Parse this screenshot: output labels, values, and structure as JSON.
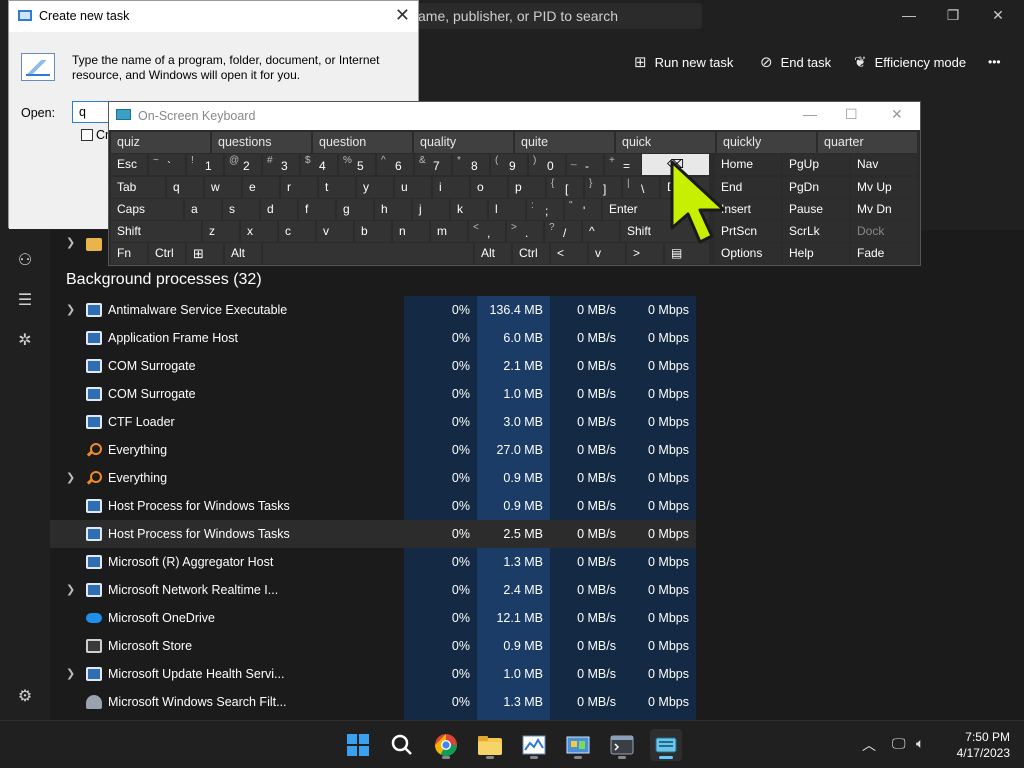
{
  "task_manager": {
    "search_placeholder": "ame, publisher, or PID to search",
    "window_controls": {
      "minimize": "—",
      "maximize": "❐",
      "close": "✕"
    },
    "toolbar": {
      "run_new_task": "Run new task",
      "end_task": "End task",
      "efficiency_mode": "Efficiency mode",
      "more": "•••"
    },
    "section_title": "Background processes (32)",
    "processes": [
      {
        "name": "Antimalware Service Executable",
        "cpu": "0%",
        "memory": "136.4 MB",
        "disk": "0 MB/s",
        "network": "0 Mbps",
        "expand": true,
        "icon": "system-app-icon"
      },
      {
        "name": "Application Frame Host",
        "cpu": "0%",
        "memory": "6.0 MB",
        "disk": "0 MB/s",
        "network": "0 Mbps",
        "expand": false,
        "icon": "system-app-icon"
      },
      {
        "name": "COM Surrogate",
        "cpu": "0%",
        "memory": "2.1 MB",
        "disk": "0 MB/s",
        "network": "0 Mbps",
        "expand": false,
        "icon": "system-app-icon"
      },
      {
        "name": "COM Surrogate",
        "cpu": "0%",
        "memory": "1.0 MB",
        "disk": "0 MB/s",
        "network": "0 Mbps",
        "expand": false,
        "icon": "system-app-icon"
      },
      {
        "name": "CTF Loader",
        "cpu": "0%",
        "memory": "3.0 MB",
        "disk": "0 MB/s",
        "network": "0 Mbps",
        "expand": false,
        "icon": "system-app-icon"
      },
      {
        "name": "Everything",
        "cpu": "0%",
        "memory": "27.0 MB",
        "disk": "0 MB/s",
        "network": "0 Mbps",
        "expand": false,
        "icon": "search-icon"
      },
      {
        "name": "Everything",
        "cpu": "0%",
        "memory": "0.9 MB",
        "disk": "0 MB/s",
        "network": "0 Mbps",
        "expand": true,
        "icon": "search-icon"
      },
      {
        "name": "Host Process for Windows Tasks",
        "cpu": "0%",
        "memory": "0.9 MB",
        "disk": "0 MB/s",
        "network": "0 Mbps",
        "expand": false,
        "icon": "system-app-icon"
      },
      {
        "name": "Host Process for Windows Tasks",
        "cpu": "0%",
        "memory": "2.5 MB",
        "disk": "0 MB/s",
        "network": "0 Mbps",
        "expand": false,
        "icon": "system-app-icon",
        "highlighted": true
      },
      {
        "name": "Microsoft (R) Aggregator Host",
        "cpu": "0%",
        "memory": "1.3 MB",
        "disk": "0 MB/s",
        "network": "0 Mbps",
        "expand": false,
        "icon": "system-app-icon"
      },
      {
        "name": "Microsoft Network Realtime I...",
        "cpu": "0%",
        "memory": "2.4 MB",
        "disk": "0 MB/s",
        "network": "0 Mbps",
        "expand": true,
        "icon": "system-app-icon"
      },
      {
        "name": "Microsoft OneDrive",
        "cpu": "0%",
        "memory": "12.1 MB",
        "disk": "0 MB/s",
        "network": "0 Mbps",
        "expand": false,
        "icon": "cloud-icon"
      },
      {
        "name": "Microsoft Store",
        "cpu": "0%",
        "memory": "0.9 MB",
        "disk": "0 MB/s",
        "network": "0 Mbps",
        "expand": false,
        "icon": "store-icon"
      },
      {
        "name": "Microsoft Update Health Servi...",
        "cpu": "0%",
        "memory": "1.0 MB",
        "disk": "0 MB/s",
        "network": "0 Mbps",
        "expand": true,
        "icon": "system-app-icon"
      },
      {
        "name": "Microsoft Windows Search Filt...",
        "cpu": "0%",
        "memory": "1.3 MB",
        "disk": "0 MB/s",
        "network": "0 Mbps",
        "expand": false,
        "icon": "user-icon"
      }
    ]
  },
  "dialog": {
    "title": "Create new task",
    "close": "✕",
    "description": "Type the name of a program, folder, document, or Internet resource, and Windows will open it for you.",
    "open_label": "Open:",
    "open_value": "q",
    "checkbox_label": "Cr"
  },
  "osk": {
    "title": "On-Screen Keyboard",
    "controls": {
      "minimize": "—",
      "maximize": "☐",
      "close": "✕"
    },
    "suggestions": [
      "quiz",
      "questions",
      "question",
      "quality",
      "quite",
      "quick",
      "quickly",
      "quarter"
    ],
    "row1": {
      "esc": "Esc",
      "keys": [
        {
          "s": "~",
          "m": "`"
        },
        {
          "s": "!",
          "m": "1"
        },
        {
          "s": "@",
          "m": "2"
        },
        {
          "s": "#",
          "m": "3"
        },
        {
          "s": "$",
          "m": "4"
        },
        {
          "s": "%",
          "m": "5"
        },
        {
          "s": "^",
          "m": "6"
        },
        {
          "s": "&",
          "m": "7"
        },
        {
          "s": "*",
          "m": "8"
        },
        {
          "s": "(",
          "m": "9"
        },
        {
          "s": ")",
          "m": "0"
        },
        {
          "s": "_",
          "m": "-"
        },
        {
          "s": "+",
          "m": "="
        }
      ],
      "backspace": "⌫"
    },
    "row2": {
      "tab": "Tab",
      "letters": [
        "q",
        "w",
        "e",
        "r",
        "t",
        "y",
        "u",
        "i",
        "o",
        "p"
      ],
      "brackets": [
        {
          "s": "{",
          "m": "["
        },
        {
          "s": "}",
          "m": "]"
        },
        {
          "s": "|",
          "m": "\\"
        }
      ],
      "del": "D"
    },
    "row3": {
      "caps": "Caps",
      "letters": [
        "a",
        "s",
        "d",
        "f",
        "g",
        "h",
        "j",
        "k",
        "l"
      ],
      "punct": [
        {
          "s": ":",
          "m": ";"
        },
        {
          "s": "\"",
          "m": "'"
        }
      ],
      "enter": "Enter"
    },
    "row4": {
      "shift": "Shift",
      "letters": [
        "z",
        "x",
        "c",
        "v",
        "b",
        "n",
        "m"
      ],
      "punct": [
        {
          "s": "<",
          "m": ","
        },
        {
          "s": ">",
          "m": "."
        },
        {
          "s": "?",
          "m": "/"
        }
      ],
      "up": "^",
      "shift_right": "Shift"
    },
    "row5": {
      "fn": "Fn",
      "ctrl": "Ctrl",
      "alt": "Alt",
      "alt_right": "Alt",
      "ctrl_right": "Ctrl",
      "left": "<",
      "down": "v",
      "right": ">"
    },
    "nav_keys": [
      [
        "Home",
        "PgUp",
        "Nav"
      ],
      [
        "End",
        "PgDn",
        "Mv Up"
      ],
      [
        "Insert",
        "Pause",
        "Mv Dn"
      ],
      [
        "PrtScn",
        "ScrLk",
        "Dock"
      ],
      [
        "Options",
        "Help",
        "Fade"
      ]
    ]
  },
  "taskbar": {
    "time": "7:50 PM",
    "date": "4/17/2023"
  }
}
